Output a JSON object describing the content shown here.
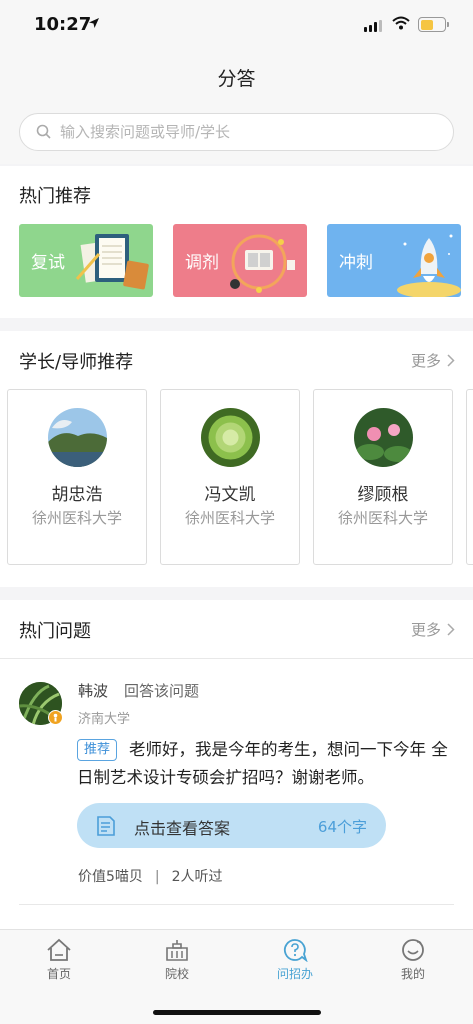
{
  "status_bar": {
    "time": "10:27"
  },
  "nav": {
    "title": "分答"
  },
  "search": {
    "placeholder": "输入搜索问题或导师/学长"
  },
  "hot": {
    "title": "热门推荐",
    "cards": [
      {
        "label": "复试",
        "color": "#8fd68d"
      },
      {
        "label": "调剂",
        "color": "#ee7d8a"
      },
      {
        "label": "冲刺",
        "color": "#6fb3ef"
      }
    ]
  },
  "mentors": {
    "title": "学长/导师推荐",
    "more": "更多",
    "items": [
      {
        "name": "胡忠浩",
        "school": "徐州医科大学"
      },
      {
        "name": "冯文凯",
        "school": "徐州医科大学"
      },
      {
        "name": "缪顾根",
        "school": "徐州医科大学"
      }
    ]
  },
  "questions": {
    "title": "热门问题",
    "more": "更多",
    "items": [
      {
        "name": "韩波",
        "action": "回答该问题",
        "school": "济南大学",
        "tag": "推荐",
        "text": "老师好，我是今年的考生，想问一下今年 全日制艺术设计专硕会扩招吗？谢谢老师。",
        "answer_label": "点击查看答案",
        "answer_count": "64个字",
        "price": "价值5喵贝",
        "listeners": "2人听过"
      }
    ]
  },
  "tabs": [
    {
      "label": "首页",
      "icon": "home-icon",
      "active": false
    },
    {
      "label": "院校",
      "icon": "school-icon",
      "active": false
    },
    {
      "label": "问招办",
      "icon": "question-bubble-icon",
      "active": true
    },
    {
      "label": "我的",
      "icon": "profile-icon",
      "active": false
    }
  ],
  "colors": {
    "accent": "#49a3d3",
    "tag": "#3c8fd8",
    "answer_bg": "#bfe0f5"
  }
}
